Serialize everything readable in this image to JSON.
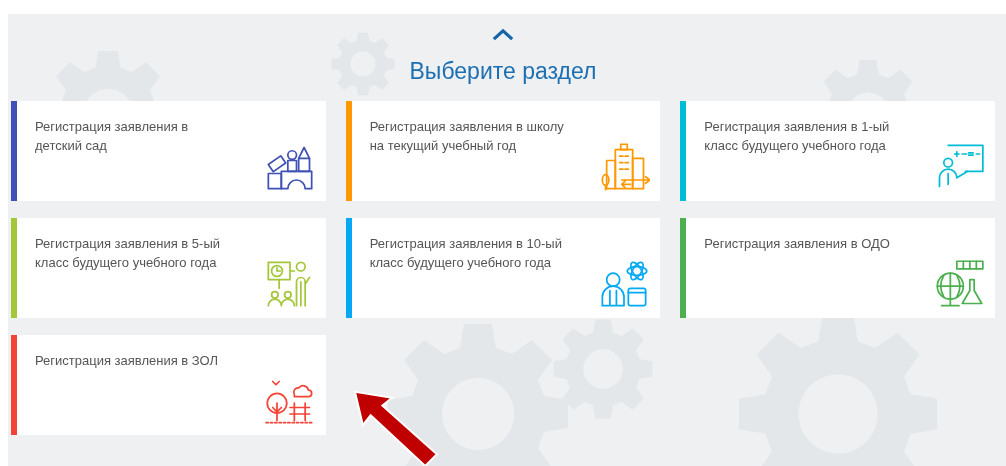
{
  "heading": "Выберите раздел",
  "sections": [
    {
      "title": "Регистрация заявления в детский сад",
      "color": "#3f51b5",
      "kind": "blocks"
    },
    {
      "title": "Регистрация заявления в школу на текущий учебный год",
      "color": "#ff9800",
      "kind": "school"
    },
    {
      "title": "Регистрация заявления в 1-ый класс будущего учебного года",
      "color": "#00bcd4",
      "kind": "teacher"
    },
    {
      "title": "Регистрация заявления в 5-ый класс будущего учебного года",
      "color": "#a4c639",
      "kind": "lecture"
    },
    {
      "title": "Регистрация заявления в 10-ый класс будущего учебного года",
      "color": "#03a9f4",
      "kind": "student"
    },
    {
      "title": "Регистрация заявления в ОДО",
      "color": "#4caf50",
      "kind": "science"
    },
    {
      "title": "Регистрация заявления в ЗОЛ",
      "color": "#f44336",
      "kind": "camp"
    }
  ]
}
